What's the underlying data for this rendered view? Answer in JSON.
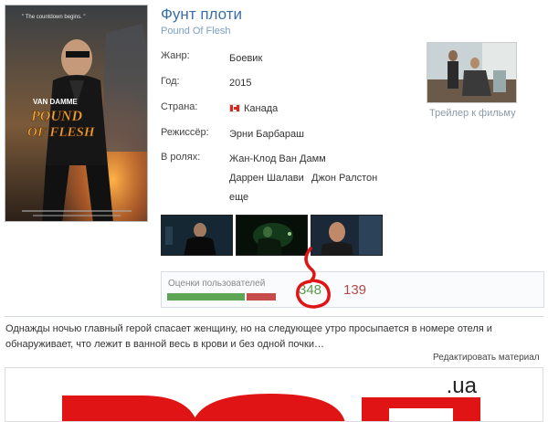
{
  "movie": {
    "title": "Фунт плоти",
    "original_title": "Pound Of Flesh",
    "poster": {
      "tagline": "\" The countdown begins. \"",
      "actor_name": "VAN DAMME",
      "movie_title_line1": "POUND",
      "movie_title_line2": "OF FLESH"
    }
  },
  "details": {
    "genre_label": "Жанр:",
    "genre_value": "Боевик",
    "year_label": "Год:",
    "year_value": "2015",
    "country_label": "Страна:",
    "country_value": "Канада",
    "country_flag": "canada-flag-icon",
    "director_label": "Режиссёр:",
    "director_value": "Эрни Барбараш",
    "cast_label": "В ролях:",
    "cast": [
      "Жан-Клод Ван Дамм",
      "Даррен Шалави",
      "Джон Ралстон"
    ],
    "cast_more": "еще"
  },
  "trailer": {
    "label": "Трейлер к фильму"
  },
  "rating": {
    "label": "Оценки пользователей",
    "likes": "348",
    "dislikes": "139",
    "like_fraction": 0.715,
    "like_color": "#5fa556",
    "dislike_color": "#c64b4b"
  },
  "description": "Однажды ночью главный герой спасает женщину, но на следующее утро просыпается в номере отеля и обнаруживает, что лежит в ванной весь в крови и без одной почки…",
  "edit_label": "Редактировать материал",
  "banner": {
    "text": ".ua",
    "accent_color": "#e01414"
  }
}
